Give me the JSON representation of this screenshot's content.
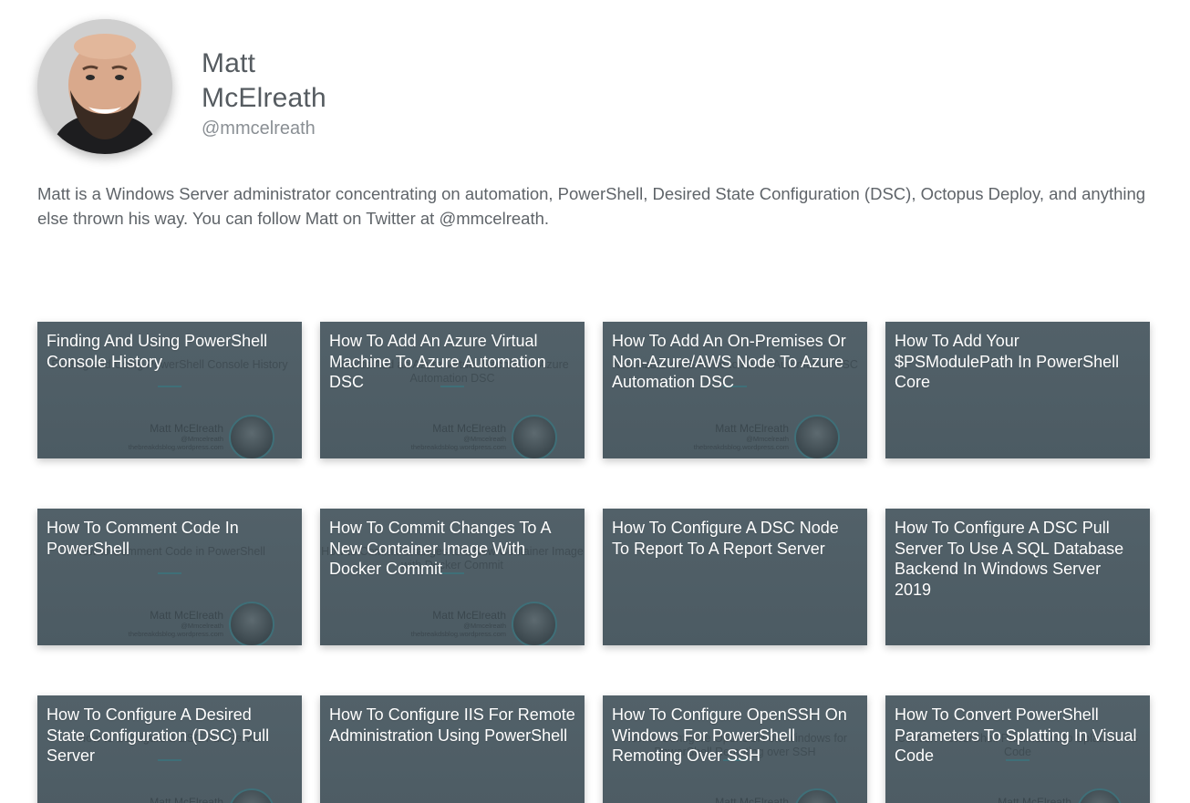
{
  "profile": {
    "name": "Matt McElreath",
    "handle": "@mmcelreath",
    "bio": "Matt is a Windows Server administrator concentrating on automation, PowerShell, Desired State Configuration (DSC), Octopus Deploy, and anything else thrown his way. You can follow Matt on Twitter at @mmcelreath."
  },
  "thumb_byline": {
    "name": "Matt McElreath",
    "handle": "@Mmcelreath",
    "url": "thebreakdsblog.wordpress.com"
  },
  "articles": [
    {
      "title": "Finding And Using PowerShell Console History",
      "thumb_text": "Finding and Using PowerShell Console History",
      "has_byline": true
    },
    {
      "title": "How To Add An Azure Virtual Machine To Azure Automation DSC",
      "thumb_text": "How to Add an Azure Virtual Machine to Azure Automation DSC",
      "has_byline": true
    },
    {
      "title": "How To Add An On-Premises Or Non-Azure/AWS Node To Azure Automation DSC",
      "thumb_text": "Non-Azure/AWS Node to Azure Automation DSC",
      "has_byline": true
    },
    {
      "title": "How To Add Your $PSModulePath In PowerShell Core",
      "thumb_text": "",
      "has_byline": false
    },
    {
      "title": "How To Comment Code In PowerShell",
      "thumb_text": "How to Comment Code in PowerShell",
      "has_byline": true
    },
    {
      "title": "How To Commit Changes To A New Container Image With Docker Commit",
      "thumb_text": "How to Commit Changes to a New Container Image with Docker Commit",
      "has_byline": true
    },
    {
      "title": "How To Configure A DSC Node To Report To A Report Server",
      "thumb_text": "",
      "has_byline": false
    },
    {
      "title": "How To Configure A DSC Pull Server To Use A SQL Database Backend In Windows Server 2019",
      "thumb_text": "",
      "has_byline": false
    },
    {
      "title": "How To Configure A Desired State Configuration (DSC) Pull Server",
      "thumb_text": "How to Configure a DSC Pull Server",
      "has_byline": true
    },
    {
      "title": "How To Configure IIS For Remote Administration Using PowerShell",
      "thumb_text": "",
      "has_byline": false
    },
    {
      "title": "How To Configure OpenSSH On Windows For PowerShell Remoting Over SSH",
      "thumb_text": "How to Configure OpenSSH on Windows for PowerShell Remoting over SSH",
      "has_byline": true
    },
    {
      "title": "How To Convert PowerShell Parameters To Splatting In Visual Code",
      "thumb_text": "Convert PowerShell Parameters to Splats in VS Code",
      "has_byline": true
    }
  ],
  "colors": {
    "card_bg": "#4f5f67",
    "title_text": "#ffffff",
    "name_text": "#555b60",
    "bio_text": "#5f6469"
  }
}
